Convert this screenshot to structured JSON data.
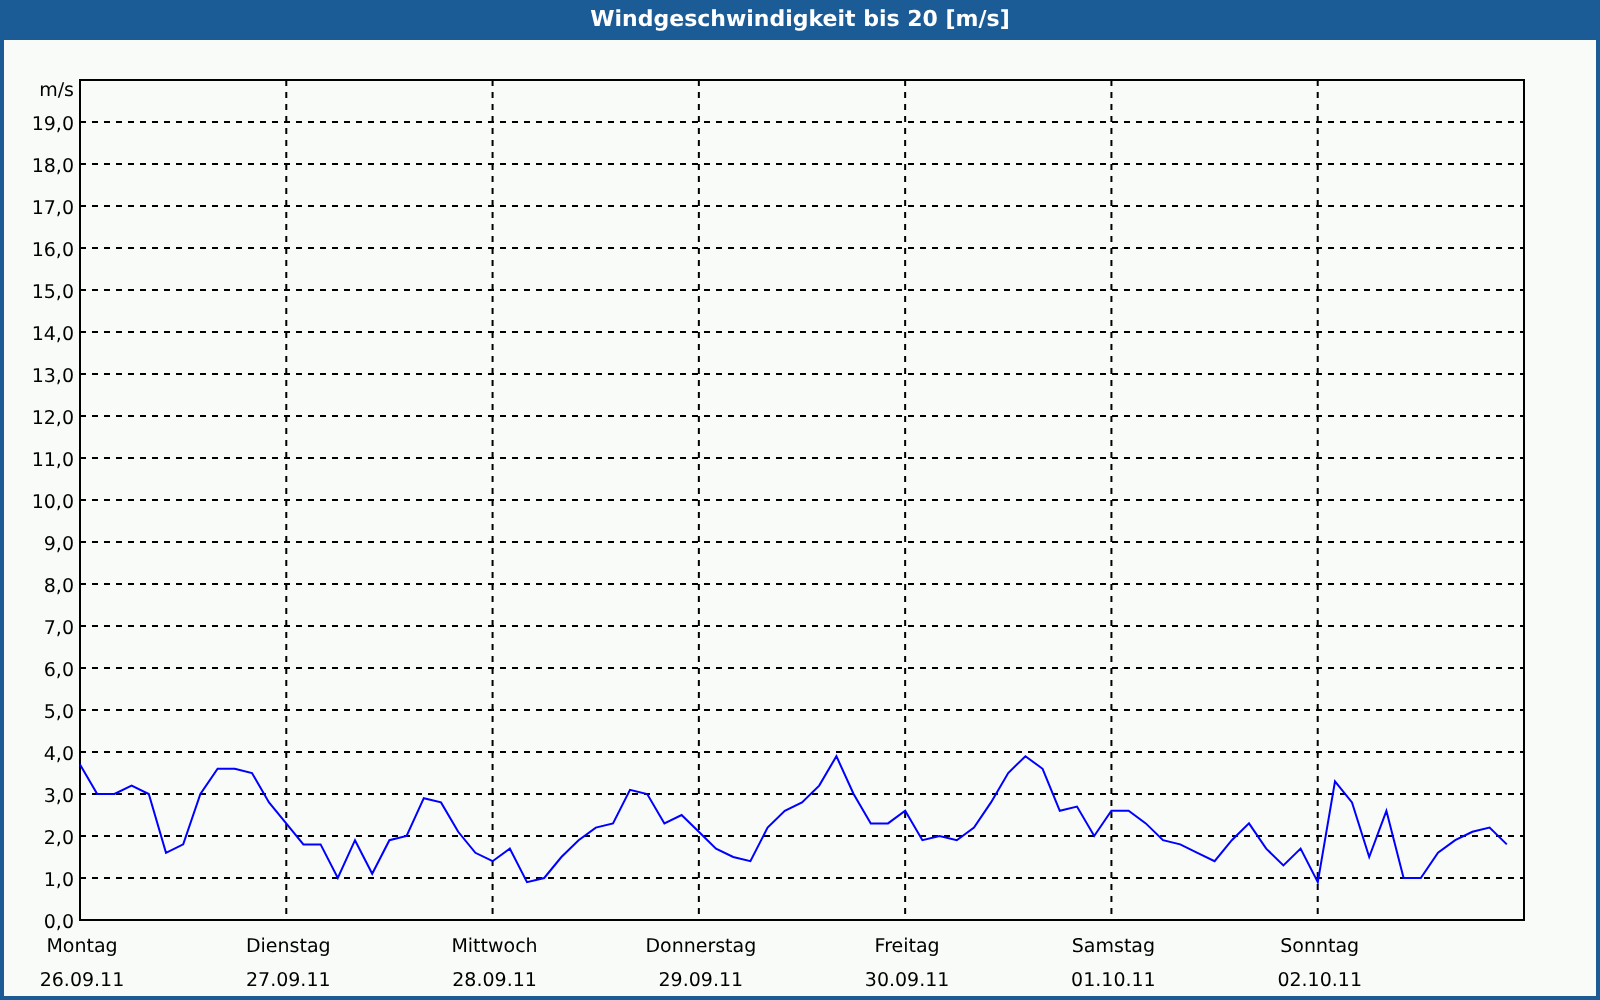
{
  "window": {
    "title": "Windgeschwindigkeit bis 20 [m/s]"
  },
  "chart": {
    "tick_dates": [
      "26.09.11",
      "27.09.11",
      "28.09.11",
      "29.09.11",
      "30.09.11",
      "01.10.11",
      "02.10.11"
    ],
    "chart_data": {
      "type": "line",
      "ylabel": "m/s",
      "grid": true,
      "ylim": [
        0,
        20
      ],
      "categories": [
        "Montag",
        null,
        null,
        null,
        null,
        null,
        null,
        null,
        null,
        null,
        null,
        null,
        "Dienstag",
        null,
        null,
        null,
        null,
        null,
        null,
        null,
        null,
        null,
        null,
        null,
        "Mittwoch",
        null,
        null,
        null,
        null,
        null,
        null,
        null,
        null,
        null,
        null,
        null,
        "Donnerstag",
        null,
        null,
        null,
        null,
        null,
        null,
        null,
        null,
        null,
        null,
        null,
        "Freitag",
        null,
        null,
        null,
        null,
        null,
        null,
        null,
        null,
        null,
        null,
        null,
        "Samstag",
        null,
        null,
        null,
        null,
        null,
        null,
        null,
        null,
        null,
        null,
        null,
        "Sonntag",
        null,
        null,
        null,
        null,
        null,
        null,
        null,
        null,
        null,
        null,
        null
      ],
      "yticks": [
        {
          "value": 0,
          "label": "0,0"
        },
        {
          "value": 1,
          "label": "1,0"
        },
        {
          "value": 2,
          "label": "2,0"
        },
        {
          "value": 3,
          "label": "3,0"
        },
        {
          "value": 4,
          "label": "4,0"
        },
        {
          "value": 5,
          "label": "5,0"
        },
        {
          "value": 6,
          "label": "6,0"
        },
        {
          "value": 7,
          "label": "7,0"
        },
        {
          "value": 8,
          "label": "8,0"
        },
        {
          "value": 9,
          "label": "9,0"
        },
        {
          "value": 10,
          "label": "10,0"
        },
        {
          "value": 11,
          "label": "11,0"
        },
        {
          "value": 12,
          "label": "12,0"
        },
        {
          "value": 13,
          "label": "13,0"
        },
        {
          "value": 14,
          "label": "14,0"
        },
        {
          "value": 15,
          "label": "15,0"
        },
        {
          "value": 16,
          "label": "16,0"
        },
        {
          "value": 17,
          "label": "17,0"
        },
        {
          "value": 18,
          "label": "18,0"
        },
        {
          "value": 19,
          "label": "19,0"
        }
      ],
      "series": [
        {
          "color": "#0000ff",
          "values": [
            3.7,
            3.0,
            3.0,
            3.2,
            3.0,
            1.6,
            1.8,
            3.0,
            3.6,
            3.6,
            3.5,
            2.8,
            2.3,
            1.8,
            1.8,
            1.0,
            1.9,
            1.1,
            1.9,
            2.0,
            2.9,
            2.8,
            2.1,
            1.6,
            1.4,
            1.7,
            0.9,
            1.0,
            1.5,
            1.9,
            2.2,
            2.3,
            3.1,
            3.0,
            2.3,
            2.5,
            2.1,
            1.7,
            1.5,
            1.4,
            2.2,
            2.6,
            2.8,
            3.2,
            3.9,
            3.0,
            2.3,
            2.3,
            2.6,
            1.9,
            2.0,
            1.9,
            2.2,
            2.8,
            3.5,
            3.9,
            3.6,
            2.6,
            2.7,
            2.0,
            2.6,
            2.6,
            2.3,
            1.9,
            1.8,
            1.6,
            1.4,
            1.9,
            2.3,
            1.7,
            1.3,
            1.7,
            0.9,
            3.3,
            2.8,
            1.5,
            2.6,
            1.0,
            1.0,
            1.6,
            1.9,
            2.1,
            2.2,
            1.8
          ]
        }
      ]
    }
  }
}
